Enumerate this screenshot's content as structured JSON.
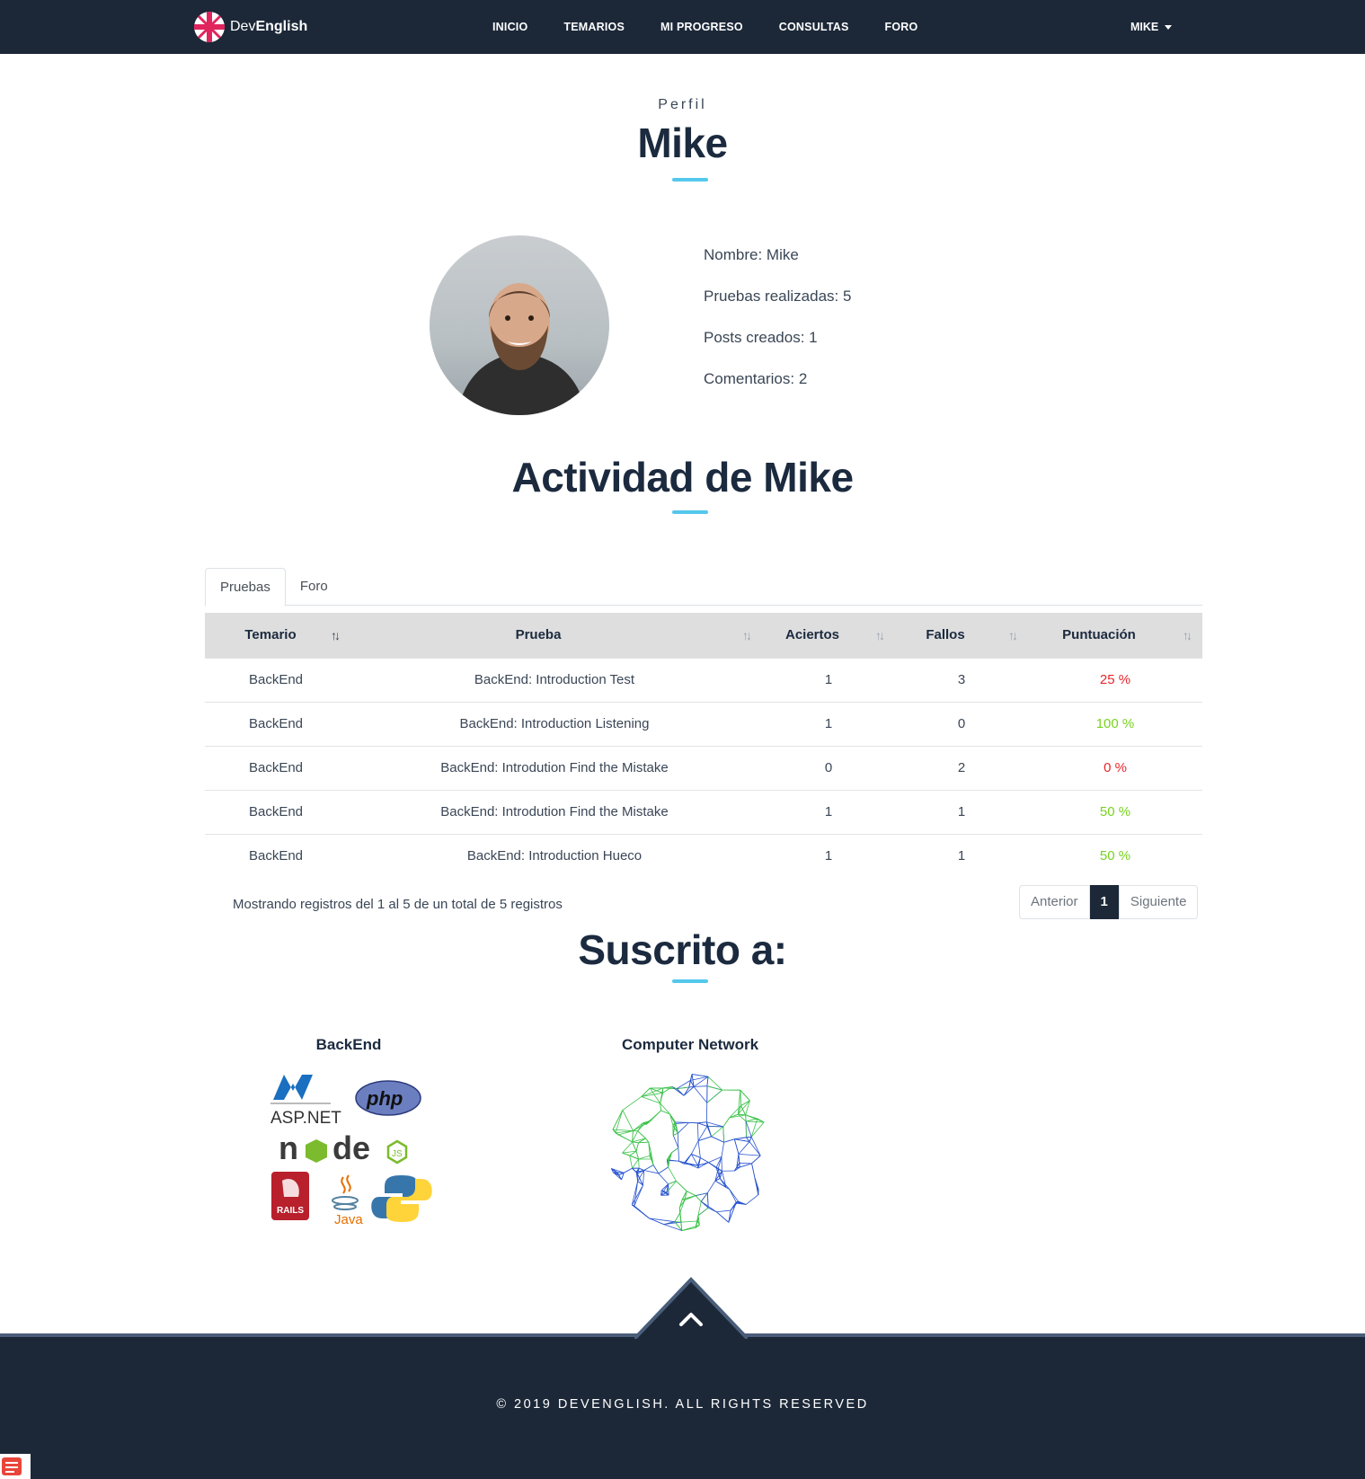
{
  "nav": {
    "brand_prefix": "Dev",
    "brand_suffix": "English",
    "links": [
      "INICIO",
      "TEMARIOS",
      "MI PROGRESO",
      "CONSULTAS",
      "FORO"
    ],
    "user": "MIKE"
  },
  "profile": {
    "eyebrow": "Perfil",
    "name": "Mike",
    "info": [
      "Nombre: Mike",
      "Pruebas realizadas: 5",
      "Posts creados: 1",
      "Comentarios: 2"
    ]
  },
  "activity": {
    "title": "Actividad de Mike",
    "tabs": [
      "Pruebas",
      "Foro"
    ],
    "columns": [
      "Temario",
      "Prueba",
      "Aciertos",
      "Fallos",
      "Puntuación"
    ],
    "rows": [
      {
        "temario": "BackEnd",
        "prueba": "BackEnd: Introduction Test",
        "aciertos": "1",
        "fallos": "3",
        "puntuacion": "25 %",
        "status": "low"
      },
      {
        "temario": "BackEnd",
        "prueba": "BackEnd: Introduction Listening",
        "aciertos": "1",
        "fallos": "0",
        "puntuacion": "100 %",
        "status": "high"
      },
      {
        "temario": "BackEnd",
        "prueba": "BackEnd: Introdution Find the Mistake",
        "aciertos": "0",
        "fallos": "2",
        "puntuacion": "0 %",
        "status": "low"
      },
      {
        "temario": "BackEnd",
        "prueba": "BackEnd: Introdution Find the Mistake",
        "aciertos": "1",
        "fallos": "1",
        "puntuacion": "50 %",
        "status": "high"
      },
      {
        "temario": "BackEnd",
        "prueba": "BackEnd: Introduction Hueco",
        "aciertos": "1",
        "fallos": "1",
        "puntuacion": "50 %",
        "status": "high"
      }
    ],
    "info_count": "Mostrando registros del 1 al 5 de un total de 5 registros",
    "pager": {
      "prev": "Anterior",
      "current": "1",
      "next": "Siguiente"
    }
  },
  "subscriptions": {
    "title": "Suscrito a:",
    "items": [
      {
        "name": "BackEnd",
        "image": "backend-logos-collage"
      },
      {
        "name": "Computer Network",
        "image": "network-globe"
      }
    ]
  },
  "footer": {
    "copyright": "© 2019 DEVENGLISH. ALL RIGHTS RESERVED"
  },
  "colors": {
    "navy": "#1c2838",
    "accent": "#54c8ec",
    "score_low": "#e8262a",
    "score_high": "#78d21f"
  }
}
